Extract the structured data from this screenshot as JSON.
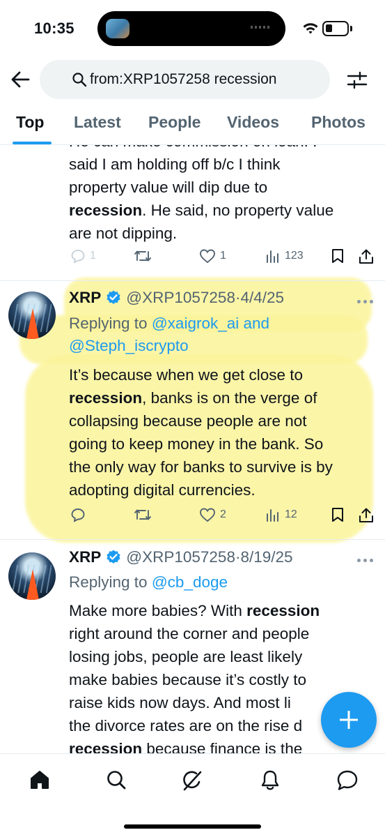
{
  "status_bar": {
    "time": "10:35"
  },
  "search": {
    "query": "from:XRP1057258 recession"
  },
  "tabs": [
    "Top",
    "Latest",
    "People",
    "Videos",
    "Photos"
  ],
  "active_tab": "Top",
  "tweets": [
    {
      "body_partial_lines": [
        "He can make commission on loan. I",
        "said I am holding off b/c I think",
        "property value will dip due to"
      ],
      "body_bold": "recession",
      "body_after": ".  He said, no property value",
      "body_last": "are not dipping.",
      "replies": "1",
      "retweets": "",
      "likes": "1",
      "views": "123"
    },
    {
      "name": "XRP",
      "handle": "@XRP1057258",
      "date": "4/4/25",
      "replying_to_label": "Replying to",
      "replying_to_1": "@xaigrok_ai",
      "replying_to_and": "and",
      "replying_to_2": "@Steph_iscrypto",
      "body_line1": "It’s because when we get close to",
      "body_bold": "recession",
      "body_line2_rest": ", banks is on the verge of",
      "body_line3": "collapsing because people are not",
      "body_line4": "going to keep money in the bank.  So",
      "body_line5": "the only way for banks to survive is by",
      "body_line6": "adopting digital currencies.",
      "replies": "",
      "retweets": "",
      "likes": "2",
      "views": "12",
      "highlight_color": "#fbf49a"
    },
    {
      "name": "XRP",
      "handle": "@XRP1057258",
      "date": "8/19/25",
      "replying_to_label": "Replying to",
      "replying_to_1": "@cb_doge",
      "body_line1_pre": "Make more babies?  With ",
      "body_bold1": "recession",
      "body_line2": "right around the corner and people",
      "body_line3": "losing jobs, people are least likely",
      "body_line4": "make babies because it’s costly to",
      "body_line5": "raise kids now days.   And most li",
      "body_line6": "the divorce rates are on the rise d",
      "body_bold2": "recession",
      "body_line7_rest": " because finance is the"
    }
  ],
  "colors": {
    "accent": "#1d9bf0",
    "secondary_text": "#536471",
    "highlight": "#fbf49a"
  },
  "bottom_nav": [
    "home-icon",
    "search-icon",
    "grok-icon",
    "notifications-icon",
    "messages-icon"
  ]
}
